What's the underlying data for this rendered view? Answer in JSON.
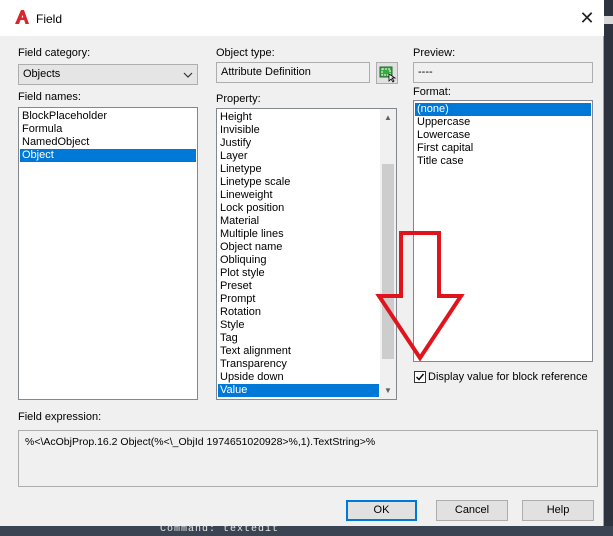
{
  "window": {
    "title": "Field",
    "close_glyph": "✕"
  },
  "field_category": {
    "label": "Field category:",
    "value": "Objects"
  },
  "field_names": {
    "label": "Field names:",
    "items": [
      "BlockPlaceholder",
      "Formula",
      "NamedObject",
      "Object"
    ],
    "selected": "Object"
  },
  "object_type": {
    "label": "Object type:",
    "value": "Attribute Definition",
    "pick_icon": "select-object-icon"
  },
  "property": {
    "label": "Property:",
    "items": [
      "Height",
      "Invisible",
      "Justify",
      "Layer",
      "Linetype",
      "Linetype scale",
      "Lineweight",
      "Lock position",
      "Material",
      "Multiple lines",
      "Object name",
      "Obliquing",
      "Plot style",
      "Preset",
      "Prompt",
      "Rotation",
      "Style",
      "Tag",
      "Text alignment",
      "Transparency",
      "Upside down",
      "Value"
    ],
    "selected": "Value"
  },
  "preview": {
    "label": "Preview:",
    "value": "----"
  },
  "format": {
    "label": "Format:",
    "items": [
      "(none)",
      "Uppercase",
      "Lowercase",
      "First capital",
      "Title case"
    ],
    "selected": "(none)"
  },
  "display_block_ref": {
    "label": "Display value for block reference",
    "checked": true
  },
  "field_expression": {
    "label": "Field expression:",
    "value": "%<\\AcObjProp.16.2 Object(%<\\_ObjId 1974651020928>%,1).TextString>%"
  },
  "buttons": {
    "ok": "OK",
    "cancel": "Cancel",
    "help": "Help"
  },
  "command_line": "Command:  textedit",
  "colors": {
    "selection": "#0078d7",
    "annotation_arrow": "#e0141c",
    "dialog_bg": "#f0f0f0"
  }
}
